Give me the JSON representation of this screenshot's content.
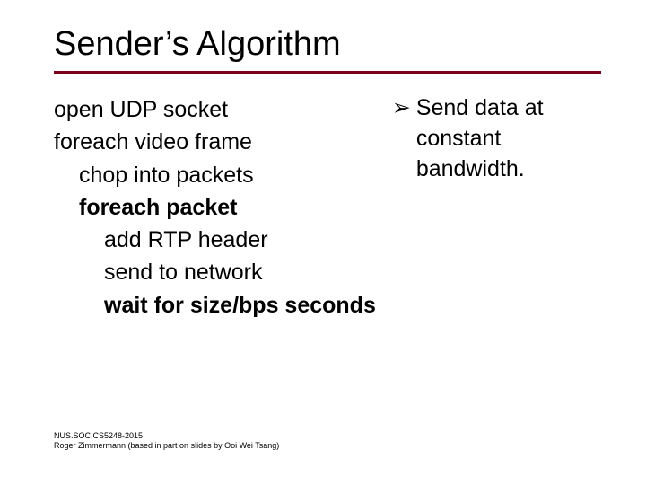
{
  "title": "Sender’s Algorithm",
  "code": {
    "line1": "open UDP socket",
    "line2": "foreach video frame",
    "line3": "chop into packets",
    "line4": "foreach packet",
    "line5": "add RTP header",
    "line6": "send to network",
    "line7": "wait for size/bps seconds"
  },
  "note": {
    "bullet_glyph": "➢",
    "text": "Send data at constant bandwidth."
  },
  "footer": {
    "line1": "NUS.SOC.CS5248-2015",
    "line2": "Roger Zimmermann (based in part on slides by Ooi Wei Tsang)"
  }
}
